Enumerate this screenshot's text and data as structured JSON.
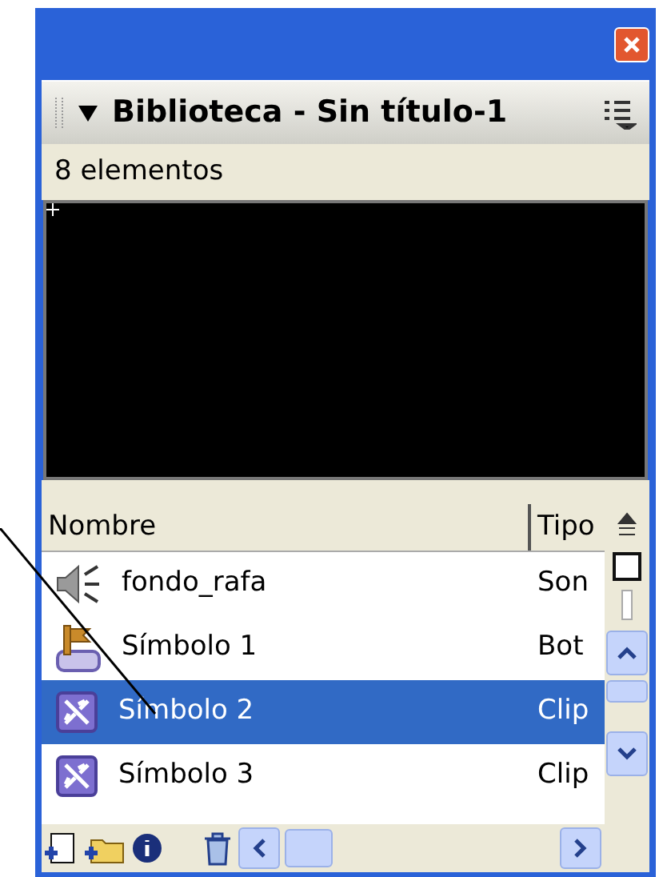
{
  "panel": {
    "title": "Biblioteca - Sin título-1",
    "expanded": true
  },
  "status": "8 elementos",
  "columns": [
    "Nombre",
    "Tipo"
  ],
  "rows": [
    {
      "name": "fondo_rafa",
      "type": "Son",
      "kind": "sound",
      "selected": false
    },
    {
      "name": "Símbolo 1",
      "type": "Bot",
      "kind": "button",
      "selected": false
    },
    {
      "name": "Símbolo 2",
      "type": "Clip",
      "kind": "movieclip",
      "selected": true
    },
    {
      "name": "Símbolo 3",
      "type": "Clip",
      "kind": "movieclip",
      "selected": false
    }
  ]
}
